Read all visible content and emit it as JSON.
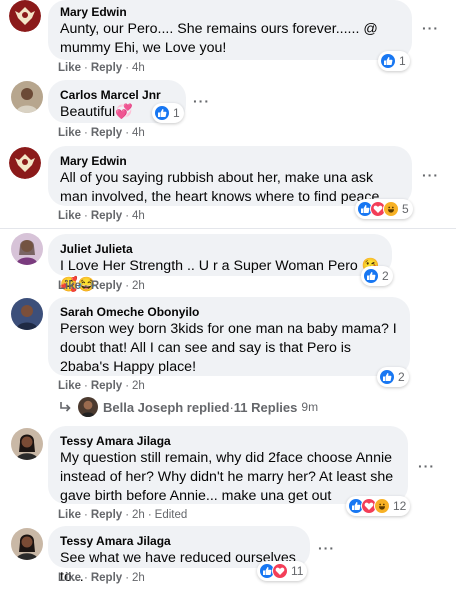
{
  "comments": [
    {
      "author": "Mary Edwin",
      "text": "Aunty, our Pero.... She remains ours forever...... @ mummy Ehi, we Love you!",
      "like": "Like",
      "reply": "Reply",
      "time": "4h",
      "reactions": [
        "like"
      ],
      "count": "1"
    },
    {
      "author": "Carlos Marcel Jnr",
      "text": "Beautiful💞",
      "like": "Like",
      "reply": "Reply",
      "time": "4h",
      "reactions": [
        "like"
      ],
      "count": "1"
    },
    {
      "author": "Mary Edwin",
      "text": "All of you saying rubbish about her, make una ask man involved, the heart knows where to find peace.",
      "like": "Like",
      "reply": "Reply",
      "time": "4h",
      "reactions": [
        "like",
        "love",
        "haha"
      ],
      "count": "5"
    },
    {
      "author": "Juliet Julieta",
      "text": "I Love Her Strength .. U r a Super Woman Pero 😘🥰😂",
      "like": "Like",
      "reply": "Reply",
      "time": "2h",
      "reactions": [
        "like"
      ],
      "count": "2"
    },
    {
      "author": "Sarah Omeche Obonyilo",
      "text": "Person wey born 3kids for one man na baby mama? I doubt that! All I can see and say is that Pero is 2baba's Happy place!",
      "like": "Like",
      "reply": "Reply",
      "time": "2h",
      "reactions": [
        "like"
      ],
      "count": "2"
    },
    {
      "author": "Tessy Amara Jilaga",
      "text": "My question still remain, why did 2face choose Annie instead of her? Why didn't he marry her? At least she gave birth before Annie... make una get out",
      "like": "Like",
      "reply": "Reply",
      "time": "2h",
      "edited": "Edited",
      "reactions": [
        "like",
        "love",
        "haha"
      ],
      "count": "12"
    },
    {
      "author": "Tessy Amara Jilaga",
      "text": "See what we have reduced ourselves to...",
      "like": "Like",
      "reply": "Reply",
      "time": "2h",
      "reactions": [
        "like",
        "love"
      ],
      "count": "11"
    }
  ],
  "replies_link": {
    "name": "Bella Joseph replied",
    "sep": " · ",
    "count": "11 Replies",
    "time": "9m"
  },
  "more_icon": "···",
  "colors": {
    "like": "#1877f2",
    "love": "#f33e58",
    "haha": "#f7b125",
    "bubble": "#f0f2f5",
    "meta": "#65676b"
  }
}
